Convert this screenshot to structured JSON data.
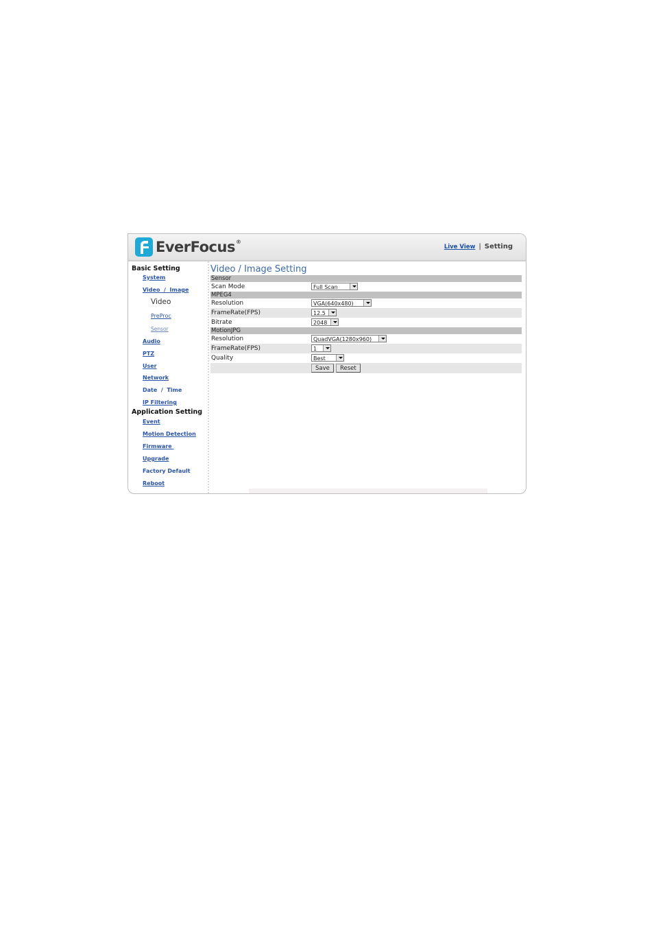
{
  "header": {
    "brand": "EverFocus",
    "brand_mark": "®",
    "nav": {
      "live_view": "Live View",
      "separator": "|",
      "setting": "Setting"
    }
  },
  "sidebar": {
    "basic_heading": "Basic Setting",
    "basic_items": [
      {
        "label": "System"
      },
      {
        "label": "Video  /  Image"
      }
    ],
    "video_sub": {
      "current": "Video",
      "preproc": "PreProc",
      "sensor": "Sensor"
    },
    "basic_items_more": [
      {
        "label": "Audio"
      },
      {
        "label": "PTZ"
      },
      {
        "label": "User"
      },
      {
        "label": "Network"
      },
      {
        "label": "Date  /  Time"
      },
      {
        "label": "IP Filtering"
      }
    ],
    "app_heading": "Application Setting",
    "app_items": [
      {
        "label": "Event"
      },
      {
        "label": "Motion Detection"
      },
      {
        "label": "Firmware "
      },
      {
        "label": "Upgrade"
      },
      {
        "label": "Factory Default"
      },
      {
        "label": "Reboot"
      }
    ]
  },
  "main": {
    "title": "Video / Image Setting",
    "sensor": {
      "section": "Sensor",
      "scan_mode": {
        "label": "Scan Mode",
        "value": "Full Scan"
      }
    },
    "mpeg4": {
      "section": "MPEG4",
      "resolution": {
        "label": "Resolution",
        "value": "VGA(640x480)"
      },
      "framerate": {
        "label": "FrameRate(FPS)",
        "value": "12.5"
      },
      "bitrate": {
        "label": "Bitrate",
        "value": "2048"
      }
    },
    "mjpg": {
      "section": "MotionJPG",
      "resolution": {
        "label": "Resolution",
        "value": "QuadVGA(1280x960)"
      },
      "framerate": {
        "label": "FrameRate(FPS)",
        "value": "1"
      },
      "quality": {
        "label": "Quality",
        "value": "Best"
      }
    },
    "buttons": {
      "save": "Save",
      "reset": "Reset"
    }
  }
}
